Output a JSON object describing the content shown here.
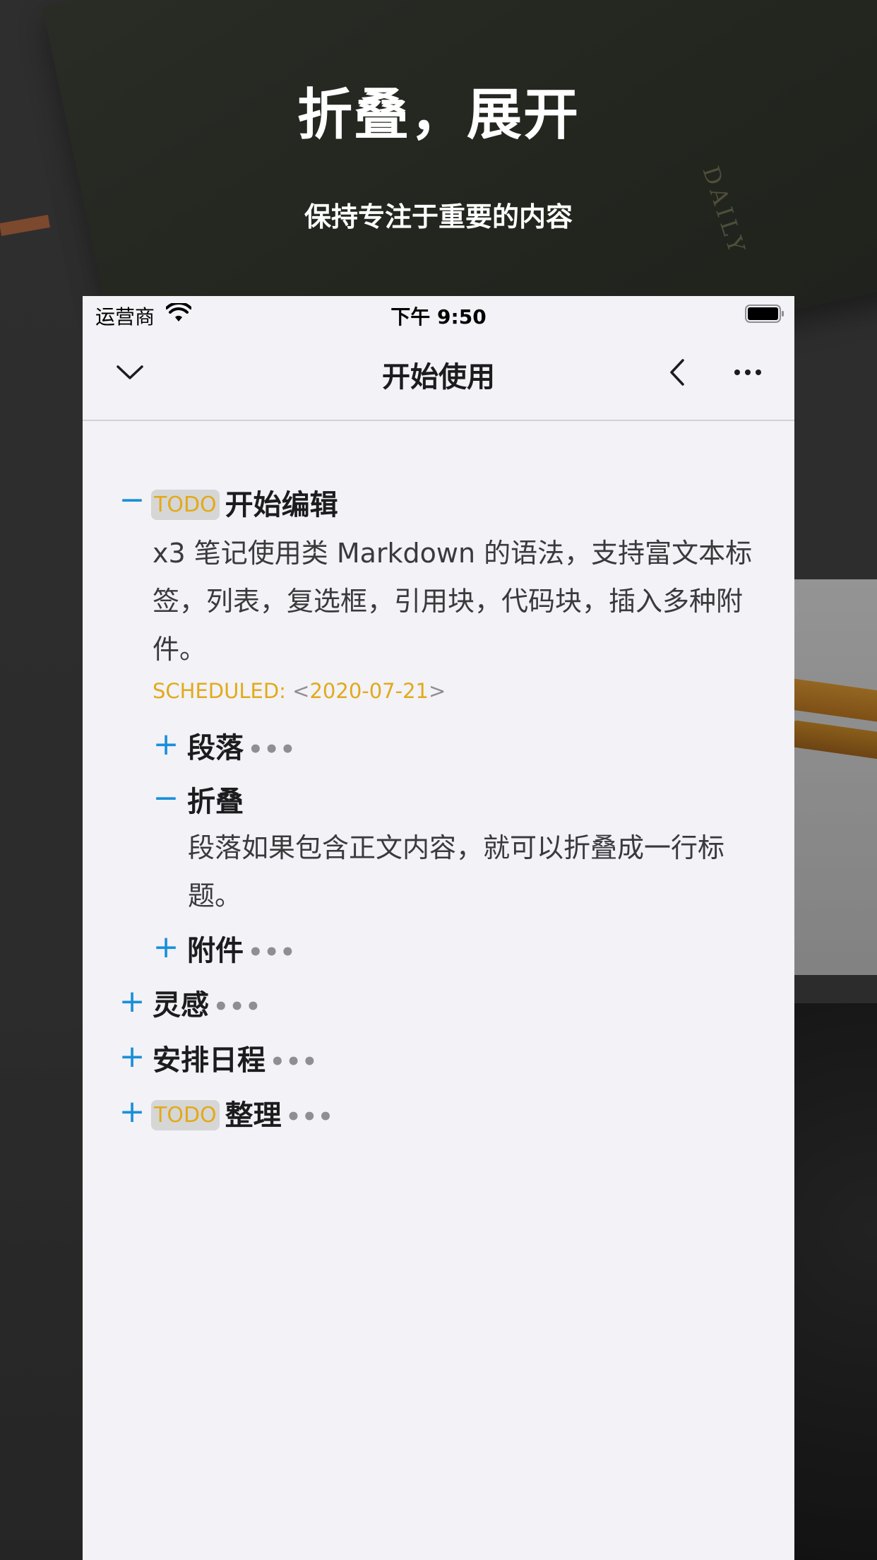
{
  "promo": {
    "title": "折叠，展开",
    "subtitle": "保持专注于重要的内容"
  },
  "background": {
    "notebook_label": "DAILY"
  },
  "status_bar": {
    "carrier": "运营商",
    "time": "下午 9:50"
  },
  "nav": {
    "title": "开始使用"
  },
  "outline": {
    "item1": {
      "todo": "TODO",
      "title": "开始编辑",
      "body": "x3 笔记使用类 Markdown 的语法，支持富文本标签，列表，复选框，引用块，代码块，插入多种附件。",
      "scheduled_label": "SCHEDULED: ",
      "scheduled_open": "<",
      "scheduled_date": "2020-07-21",
      "scheduled_close": ">",
      "children": {
        "c1": {
          "title": "段落",
          "ellipsis": "•••"
        },
        "c2": {
          "title": "折叠",
          "body": "段落如果包含正文内容，就可以折叠成一行标题。"
        },
        "c3": {
          "title": "附件",
          "ellipsis": "•••"
        }
      }
    },
    "item2": {
      "title": "灵感",
      "ellipsis": "•••"
    },
    "item3": {
      "title": "安排日程",
      "ellipsis": "•••"
    },
    "item4": {
      "todo": "TODO",
      "title": "整理",
      "ellipsis": "•••"
    }
  },
  "colors": {
    "accent_blue": "#1a8fd8",
    "todo_yellow": "#e2aa1a",
    "screen_bg": "#f2f2f7"
  }
}
